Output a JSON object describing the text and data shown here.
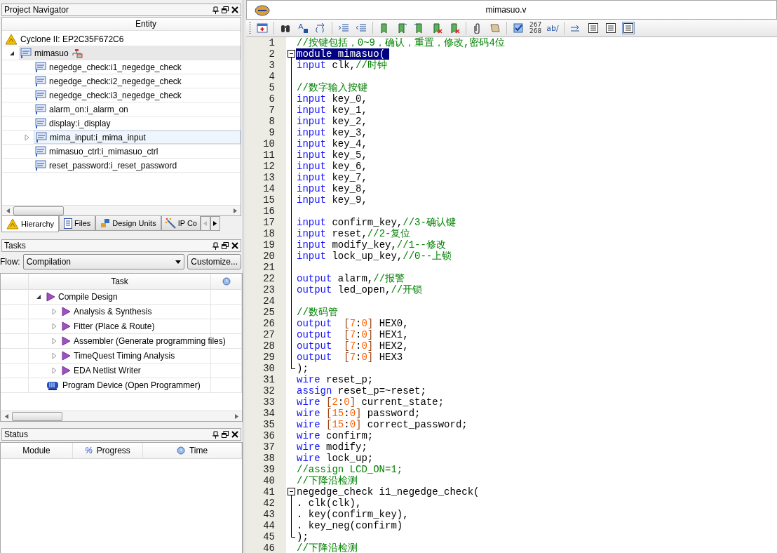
{
  "project_navigator": {
    "title": "Project Navigator",
    "column": "Entity",
    "device": "Cyclone II: EP2C35F672C6",
    "root": {
      "label": "mimasuo",
      "expanded": true,
      "selected": true,
      "children": [
        {
          "label": "negedge_check:i1_negedge_check",
          "expandable": false,
          "hovered": false,
          "selected": false
        },
        {
          "label": "negedge_check:i2_negedge_check",
          "expandable": false,
          "hovered": false,
          "selected": false
        },
        {
          "label": "negedge_check:i3_negedge_check",
          "expandable": false,
          "hovered": false,
          "selected": false
        },
        {
          "label": "alarm_on:i_alarm_on",
          "expandable": false,
          "hovered": false,
          "selected": false
        },
        {
          "label": "display:i_display",
          "expandable": false,
          "hovered": false,
          "selected": false
        },
        {
          "label": "mima_input:i_mima_input",
          "expandable": true,
          "hovered": true,
          "selected": false
        },
        {
          "label": "mimasuo_ctrl:i_mimasuo_ctrl",
          "expandable": false,
          "hovered": false,
          "selected": false
        },
        {
          "label": "reset_password:i_reset_password",
          "expandable": false,
          "hovered": false,
          "selected": false
        }
      ]
    },
    "tabs": [
      {
        "label": "Hierarchy",
        "kind": "hierarchy",
        "selected": true
      },
      {
        "label": "Files",
        "kind": "files",
        "selected": false
      },
      {
        "label": "Design Units",
        "kind": "units",
        "selected": false
      },
      {
        "label": "IP Co",
        "kind": "ip",
        "selected": false
      }
    ]
  },
  "tasks": {
    "title": "Tasks",
    "flow_label": "Flow:",
    "flow": "Compilation",
    "customize": "Customize...",
    "column": "Task",
    "items": [
      {
        "label": "Compile Design",
        "kind": "compile",
        "expandable": true,
        "expanded": true,
        "children": [
          {
            "label": "Analysis & Synthesis",
            "kind": "compile",
            "expandable": true,
            "expanded": false
          },
          {
            "label": "Fitter (Place & Route)",
            "kind": "compile",
            "expandable": true,
            "expanded": false
          },
          {
            "label": "Assembler (Generate programming files)",
            "kind": "compile",
            "expandable": true,
            "expanded": false
          },
          {
            "label": "TimeQuest Timing Analysis",
            "kind": "compile",
            "expandable": true,
            "expanded": false
          },
          {
            "label": "EDA Netlist Writer",
            "kind": "compile",
            "expandable": true,
            "expanded": false
          }
        ]
      },
      {
        "label": "Program Device (Open Programmer)",
        "kind": "program",
        "expandable": false
      }
    ]
  },
  "status": {
    "title": "Status",
    "columns": [
      {
        "label": "Module",
        "kind": "plain"
      },
      {
        "label": "Progress",
        "kind": "percent",
        "prefix": "%"
      },
      {
        "label": "Time",
        "kind": "time"
      }
    ]
  },
  "editor": {
    "title": "mimasuo.v",
    "toolbar_texts": {
      "line_numbers": [
        "267",
        "268"
      ],
      "spelling": "ab/"
    },
    "lines": [
      {
        "n": "1",
        "kind": "plain",
        "selected": false,
        "tokens": [
          {
            "kind": "cm",
            "text": "//按键包括，0~9，确认，重置，修改,密码4位"
          }
        ]
      },
      {
        "n": "2",
        "kind": "fold_start",
        "selected": true,
        "tokens": [
          {
            "kind": "kw",
            "text": "module"
          },
          {
            "kind": "id",
            "text": " mimasuo("
          }
        ]
      },
      {
        "n": "3",
        "kind": "fold_body",
        "selected": false,
        "tokens": [
          {
            "kind": "kw",
            "text": "input"
          },
          {
            "kind": "id",
            "text": " clk,"
          },
          {
            "kind": "cm",
            "text": "//时钟"
          }
        ]
      },
      {
        "n": "4",
        "kind": "fold_body",
        "selected": false
      },
      {
        "n": "5",
        "kind": "fold_body",
        "selected": false,
        "tokens": [
          {
            "kind": "cm",
            "text": "//数字输入按键"
          }
        ]
      },
      {
        "n": "6",
        "kind": "fold_body",
        "selected": false,
        "tokens": [
          {
            "kind": "kw",
            "text": "input"
          },
          {
            "kind": "id",
            "text": " key_0,"
          }
        ]
      },
      {
        "n": "7",
        "kind": "fold_body",
        "selected": false,
        "tokens": [
          {
            "kind": "kw",
            "text": "input"
          },
          {
            "kind": "id",
            "text": " key_1,"
          }
        ]
      },
      {
        "n": "8",
        "kind": "fold_body",
        "selected": false,
        "tokens": [
          {
            "kind": "kw",
            "text": "input"
          },
          {
            "kind": "id",
            "text": " key_2,"
          }
        ]
      },
      {
        "n": "9",
        "kind": "fold_body",
        "selected": false,
        "tokens": [
          {
            "kind": "kw",
            "text": "input"
          },
          {
            "kind": "id",
            "text": " key_3,"
          }
        ]
      },
      {
        "n": "10",
        "kind": "fold_body",
        "selected": false,
        "tokens": [
          {
            "kind": "kw",
            "text": "input"
          },
          {
            "kind": "id",
            "text": " key_4,"
          }
        ]
      },
      {
        "n": "11",
        "kind": "fold_body",
        "selected": false,
        "tokens": [
          {
            "kind": "kw",
            "text": "input"
          },
          {
            "kind": "id",
            "text": " key_5,"
          }
        ]
      },
      {
        "n": "12",
        "kind": "fold_body",
        "selected": false,
        "tokens": [
          {
            "kind": "kw",
            "text": "input"
          },
          {
            "kind": "id",
            "text": " key_6,"
          }
        ]
      },
      {
        "n": "13",
        "kind": "fold_body",
        "selected": false,
        "tokens": [
          {
            "kind": "kw",
            "text": "input"
          },
          {
            "kind": "id",
            "text": " key_7,"
          }
        ]
      },
      {
        "n": "14",
        "kind": "fold_body",
        "selected": false,
        "tokens": [
          {
            "kind": "kw",
            "text": "input"
          },
          {
            "kind": "id",
            "text": " key_8,"
          }
        ]
      },
      {
        "n": "15",
        "kind": "fold_body",
        "selected": false,
        "tokens": [
          {
            "kind": "kw",
            "text": "input"
          },
          {
            "kind": "id",
            "text": " key_9,"
          }
        ]
      },
      {
        "n": "16",
        "kind": "fold_body",
        "selected": false
      },
      {
        "n": "17",
        "kind": "fold_body",
        "selected": false,
        "tokens": [
          {
            "kind": "kw",
            "text": "input"
          },
          {
            "kind": "id",
            "text": " confirm_key,"
          },
          {
            "kind": "cm",
            "text": "//3-确认键"
          }
        ]
      },
      {
        "n": "18",
        "kind": "fold_body",
        "selected": false,
        "tokens": [
          {
            "kind": "kw",
            "text": "input"
          },
          {
            "kind": "id",
            "text": " reset,"
          },
          {
            "kind": "cm",
            "text": "//2-复位"
          }
        ]
      },
      {
        "n": "19",
        "kind": "fold_body",
        "selected": false,
        "tokens": [
          {
            "kind": "kw",
            "text": "input"
          },
          {
            "kind": "id",
            "text": " modify_key,"
          },
          {
            "kind": "cm",
            "text": "//1--修改"
          }
        ]
      },
      {
        "n": "20",
        "kind": "fold_body",
        "selected": false,
        "tokens": [
          {
            "kind": "kw",
            "text": "input"
          },
          {
            "kind": "id",
            "text": " lock_up_key,"
          },
          {
            "kind": "cm",
            "text": "//0--上锁"
          }
        ]
      },
      {
        "n": "21",
        "kind": "fold_body",
        "selected": false
      },
      {
        "n": "22",
        "kind": "fold_body",
        "selected": false,
        "tokens": [
          {
            "kind": "kw",
            "text": "output"
          },
          {
            "kind": "id",
            "text": " alarm,"
          },
          {
            "kind": "cm",
            "text": "//报警"
          }
        ]
      },
      {
        "n": "23",
        "kind": "fold_body",
        "selected": false,
        "tokens": [
          {
            "kind": "kw",
            "text": "output"
          },
          {
            "kind": "id",
            "text": " led_open,"
          },
          {
            "kind": "cm",
            "text": "//开锁"
          }
        ]
      },
      {
        "n": "24",
        "kind": "fold_body",
        "selected": false
      },
      {
        "n": "25",
        "kind": "fold_body",
        "selected": false,
        "tokens": [
          {
            "kind": "cm",
            "text": "//数码管"
          }
        ]
      },
      {
        "n": "26",
        "kind": "fold_body",
        "selected": false,
        "tokens": [
          {
            "kind": "kw",
            "text": "output"
          },
          {
            "kind": "br",
            "text": "  ["
          },
          {
            "kind": "num",
            "text": "7"
          },
          {
            "kind": "id",
            "text": ":"
          },
          {
            "kind": "num",
            "text": "0"
          },
          {
            "kind": "br",
            "text": "]"
          },
          {
            "kind": "id",
            "text": " HEX0,"
          }
        ]
      },
      {
        "n": "27",
        "kind": "fold_body",
        "selected": false,
        "tokens": [
          {
            "kind": "kw",
            "text": "output"
          },
          {
            "kind": "br",
            "text": "  ["
          },
          {
            "kind": "num",
            "text": "7"
          },
          {
            "kind": "id",
            "text": ":"
          },
          {
            "kind": "num",
            "text": "0"
          },
          {
            "kind": "br",
            "text": "]"
          },
          {
            "kind": "id",
            "text": " HEX1,"
          }
        ]
      },
      {
        "n": "28",
        "kind": "fold_body",
        "selected": false,
        "tokens": [
          {
            "kind": "kw",
            "text": "output"
          },
          {
            "kind": "br",
            "text": "  ["
          },
          {
            "kind": "num",
            "text": "7"
          },
          {
            "kind": "id",
            "text": ":"
          },
          {
            "kind": "num",
            "text": "0"
          },
          {
            "kind": "br",
            "text": "]"
          },
          {
            "kind": "id",
            "text": " HEX2,"
          }
        ]
      },
      {
        "n": "29",
        "kind": "fold_body",
        "selected": false,
        "tokens": [
          {
            "kind": "kw",
            "text": "output"
          },
          {
            "kind": "br",
            "text": "  ["
          },
          {
            "kind": "num",
            "text": "7"
          },
          {
            "kind": "id",
            "text": ":"
          },
          {
            "kind": "num",
            "text": "0"
          },
          {
            "kind": "br",
            "text": "]"
          },
          {
            "kind": "id",
            "text": " HEX3"
          }
        ]
      },
      {
        "n": "30",
        "kind": "fold_end",
        "selected": false,
        "tokens": [
          {
            "kind": "id",
            "text": ");"
          }
        ]
      },
      {
        "n": "31",
        "kind": "plain",
        "selected": false,
        "tokens": [
          {
            "kind": "kw",
            "text": "wire"
          },
          {
            "kind": "id",
            "text": " reset_p;"
          }
        ]
      },
      {
        "n": "32",
        "kind": "plain",
        "selected": false,
        "tokens": [
          {
            "kind": "kw",
            "text": "assign"
          },
          {
            "kind": "id",
            "text": " reset_p=~reset;"
          }
        ]
      },
      {
        "n": "33",
        "kind": "plain",
        "selected": false,
        "tokens": [
          {
            "kind": "kw",
            "text": "wire"
          },
          {
            "kind": "br",
            "text": " ["
          },
          {
            "kind": "num",
            "text": "2"
          },
          {
            "kind": "id",
            "text": ":"
          },
          {
            "kind": "num",
            "text": "0"
          },
          {
            "kind": "br",
            "text": "]"
          },
          {
            "kind": "id",
            "text": " current_state;"
          }
        ]
      },
      {
        "n": "34",
        "kind": "plain",
        "selected": false,
        "tokens": [
          {
            "kind": "kw",
            "text": "wire"
          },
          {
            "kind": "br",
            "text": " ["
          },
          {
            "kind": "num",
            "text": "15"
          },
          {
            "kind": "id",
            "text": ":"
          },
          {
            "kind": "num",
            "text": "0"
          },
          {
            "kind": "br",
            "text": "]"
          },
          {
            "kind": "id",
            "text": " password;"
          }
        ]
      },
      {
        "n": "35",
        "kind": "plain",
        "selected": false,
        "tokens": [
          {
            "kind": "kw",
            "text": "wire"
          },
          {
            "kind": "br",
            "text": " ["
          },
          {
            "kind": "num",
            "text": "15"
          },
          {
            "kind": "id",
            "text": ":"
          },
          {
            "kind": "num",
            "text": "0"
          },
          {
            "kind": "br",
            "text": "]"
          },
          {
            "kind": "id",
            "text": " correct_password;"
          }
        ]
      },
      {
        "n": "36",
        "kind": "plain",
        "selected": false,
        "tokens": [
          {
            "kind": "kw",
            "text": "wire"
          },
          {
            "kind": "id",
            "text": " confirm;"
          }
        ]
      },
      {
        "n": "37",
        "kind": "plain",
        "selected": false,
        "tokens": [
          {
            "kind": "kw",
            "text": "wire"
          },
          {
            "kind": "id",
            "text": " modify;"
          }
        ]
      },
      {
        "n": "38",
        "kind": "plain",
        "selected": false,
        "tokens": [
          {
            "kind": "kw",
            "text": "wire"
          },
          {
            "kind": "id",
            "text": " lock_up;"
          }
        ]
      },
      {
        "n": "39",
        "kind": "plain",
        "selected": false,
        "tokens": [
          {
            "kind": "cm",
            "text": "//assign LCD_ON=1;"
          }
        ]
      },
      {
        "n": "40",
        "kind": "plain",
        "selected": false,
        "tokens": [
          {
            "kind": "cm",
            "text": "//下降沿检测"
          }
        ]
      },
      {
        "n": "41",
        "kind": "fold_start",
        "selected": false,
        "tokens": [
          {
            "kind": "id",
            "text": "negedge_check i1_negedge_check("
          }
        ]
      },
      {
        "n": "42",
        "kind": "fold_body",
        "selected": false,
        "tokens": [
          {
            "kind": "id",
            "text": ". clk(clk),"
          }
        ]
      },
      {
        "n": "43",
        "kind": "fold_body",
        "selected": false,
        "tokens": [
          {
            "kind": "id",
            "text": ". key(confirm_key),"
          }
        ]
      },
      {
        "n": "44",
        "kind": "fold_body",
        "selected": false,
        "tokens": [
          {
            "kind": "id",
            "text": ". key_neg(confirm)"
          }
        ]
      },
      {
        "n": "45",
        "kind": "fold_end",
        "selected": false,
        "tokens": [
          {
            "kind": "id",
            "text": ");"
          }
        ]
      },
      {
        "n": "46",
        "kind": "plain",
        "selected": false,
        "tokens": [
          {
            "kind": "cm",
            "text": "//下降沿检测"
          }
        ]
      }
    ]
  }
}
